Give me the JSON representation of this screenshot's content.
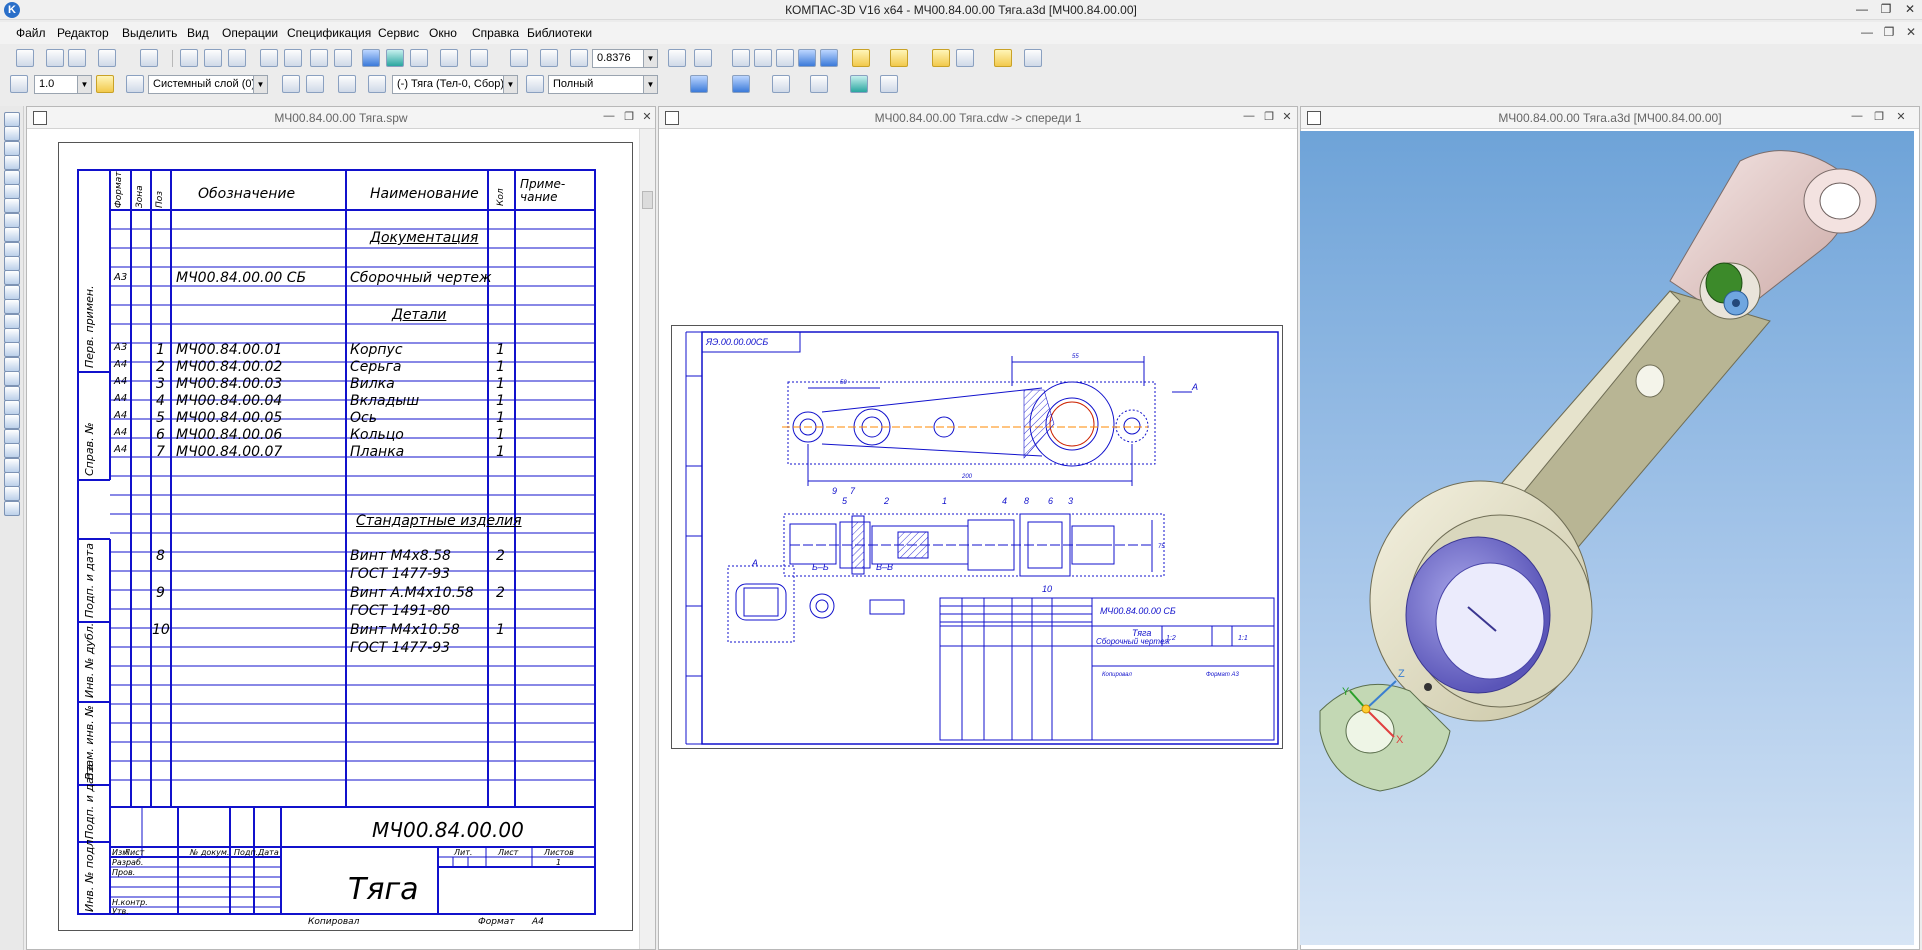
{
  "app": {
    "title": "КОМПАС-3D V16  x64 - МЧ00.84.00.00 Тяга.a3d [МЧ00.84.00.00]",
    "logo": "K"
  },
  "menu": [
    "Файл",
    "Редактор",
    "Выделить",
    "Вид",
    "Операции",
    "Спецификация",
    "Сервис",
    "Окно",
    "Справка",
    "Библиотеки"
  ],
  "toolbar1": {
    "zoom_value": "0.8376"
  },
  "toolbar2": {
    "step_value": "1.0",
    "layer_value": "Системный слой (0)",
    "layer_sel": "(-) Тяга (Тел-0, Сбор)",
    "render_mode": "Полный"
  },
  "windows": {
    "spec": {
      "title": "МЧ00.84.00.00 Тяга.spw"
    },
    "drawing": {
      "title": "МЧ00.84.00.00 Тяга.cdw -> спереди 1"
    },
    "model": {
      "title": "МЧ00.84.00.00 Тяга.a3d [МЧ00.84.00.00]"
    }
  },
  "spec": {
    "headers": {
      "format": "Формат",
      "zone": "Зона",
      "pos": "Поз",
      "designation": "Обозначение",
      "name": "Наименование",
      "qty": "Кол",
      "note": "Приме-чание"
    },
    "side_labels": [
      "Перв. примен.",
      "Справ. №",
      "Подп. и дата",
      "Инв. № дубл.",
      "Взам. инв. №",
      "Подп. и дата",
      "Инв. № подл."
    ],
    "sections": {
      "docs": "Документация",
      "parts": "Детали",
      "standard": "Стандартные изделия"
    },
    "doc_row": {
      "format": "А3",
      "designation": "МЧ00.84.00.00 СБ",
      "name": "Сборочный чертеж"
    },
    "parts": [
      {
        "format": "А3",
        "pos": "1",
        "designation": "МЧ00.84.00.01",
        "name": "Корпус",
        "qty": "1"
      },
      {
        "format": "А4",
        "pos": "2",
        "designation": "МЧ00.84.00.02",
        "name": "Серьга",
        "qty": "1"
      },
      {
        "format": "А4",
        "pos": "3",
        "designation": "МЧ00.84.00.03",
        "name": "Вилка",
        "qty": "1"
      },
      {
        "format": "А4",
        "pos": "4",
        "designation": "МЧ00.84.00.04",
        "name": "Вкладыш",
        "qty": "1"
      },
      {
        "format": "А4",
        "pos": "5",
        "designation": "МЧ00.84.00.05",
        "name": "Ось",
        "qty": "1"
      },
      {
        "format": "А4",
        "pos": "6",
        "designation": "МЧ00.84.00.06",
        "name": "Кольцо",
        "qty": "1"
      },
      {
        "format": "А4",
        "pos": "7",
        "designation": "МЧ00.84.00.07",
        "name": "Планка",
        "qty": "1"
      }
    ],
    "standard": [
      {
        "pos": "8",
        "name1": "Винт М4х8.58",
        "name2": "ГОСТ 1477-93",
        "qty": "2"
      },
      {
        "pos": "9",
        "name1": "Винт А.М4х10.58",
        "name2": "ГОСТ 1491-80",
        "qty": "2"
      },
      {
        "pos": "10",
        "name1": "Винт М4х10.58",
        "name2": "ГОСТ 1477-93",
        "qty": "1"
      }
    ],
    "stamp": {
      "code": "МЧ00.84.00.00",
      "title": "Тяга",
      "izm": "Изм",
      "list": "Лист",
      "doc_no": "№ докум.",
      "sign": "Подп.",
      "date": "Дата",
      "razrab": "Разраб.",
      "prov": "Пров.",
      "nkontr": "Н.контр.",
      "utv": "Утв.",
      "lit": "Лит.",
      "sheet": "Лист",
      "sheets": "Листов",
      "sheet_no": "1",
      "copied": "Копировал",
      "format_lbl": "Формат",
      "format_val": "А4"
    }
  },
  "drawing": {
    "top_code": "ЯЭ.00.00.00СБ",
    "callouts": [
      "7",
      "9",
      "5",
      "2",
      "1",
      "4",
      "8",
      "6",
      "3",
      "10"
    ],
    "views": {
      "a": "А",
      "bb": "Б–Б",
      "vv": "В–В"
    },
    "stamp": {
      "code": "МЧ00.84.00.00 СБ",
      "name": "Тяга",
      "sub": "Сборочный чертеж",
      "mass": "1:2",
      "scale": "1:1",
      "copied": "Копировал",
      "format": "Формат  А3"
    },
    "dims": {
      "d1": "55",
      "d2": "50",
      "d3": "200",
      "d4": "75"
    }
  },
  "axes": {
    "x": "X",
    "y": "Y",
    "z": "Z"
  }
}
